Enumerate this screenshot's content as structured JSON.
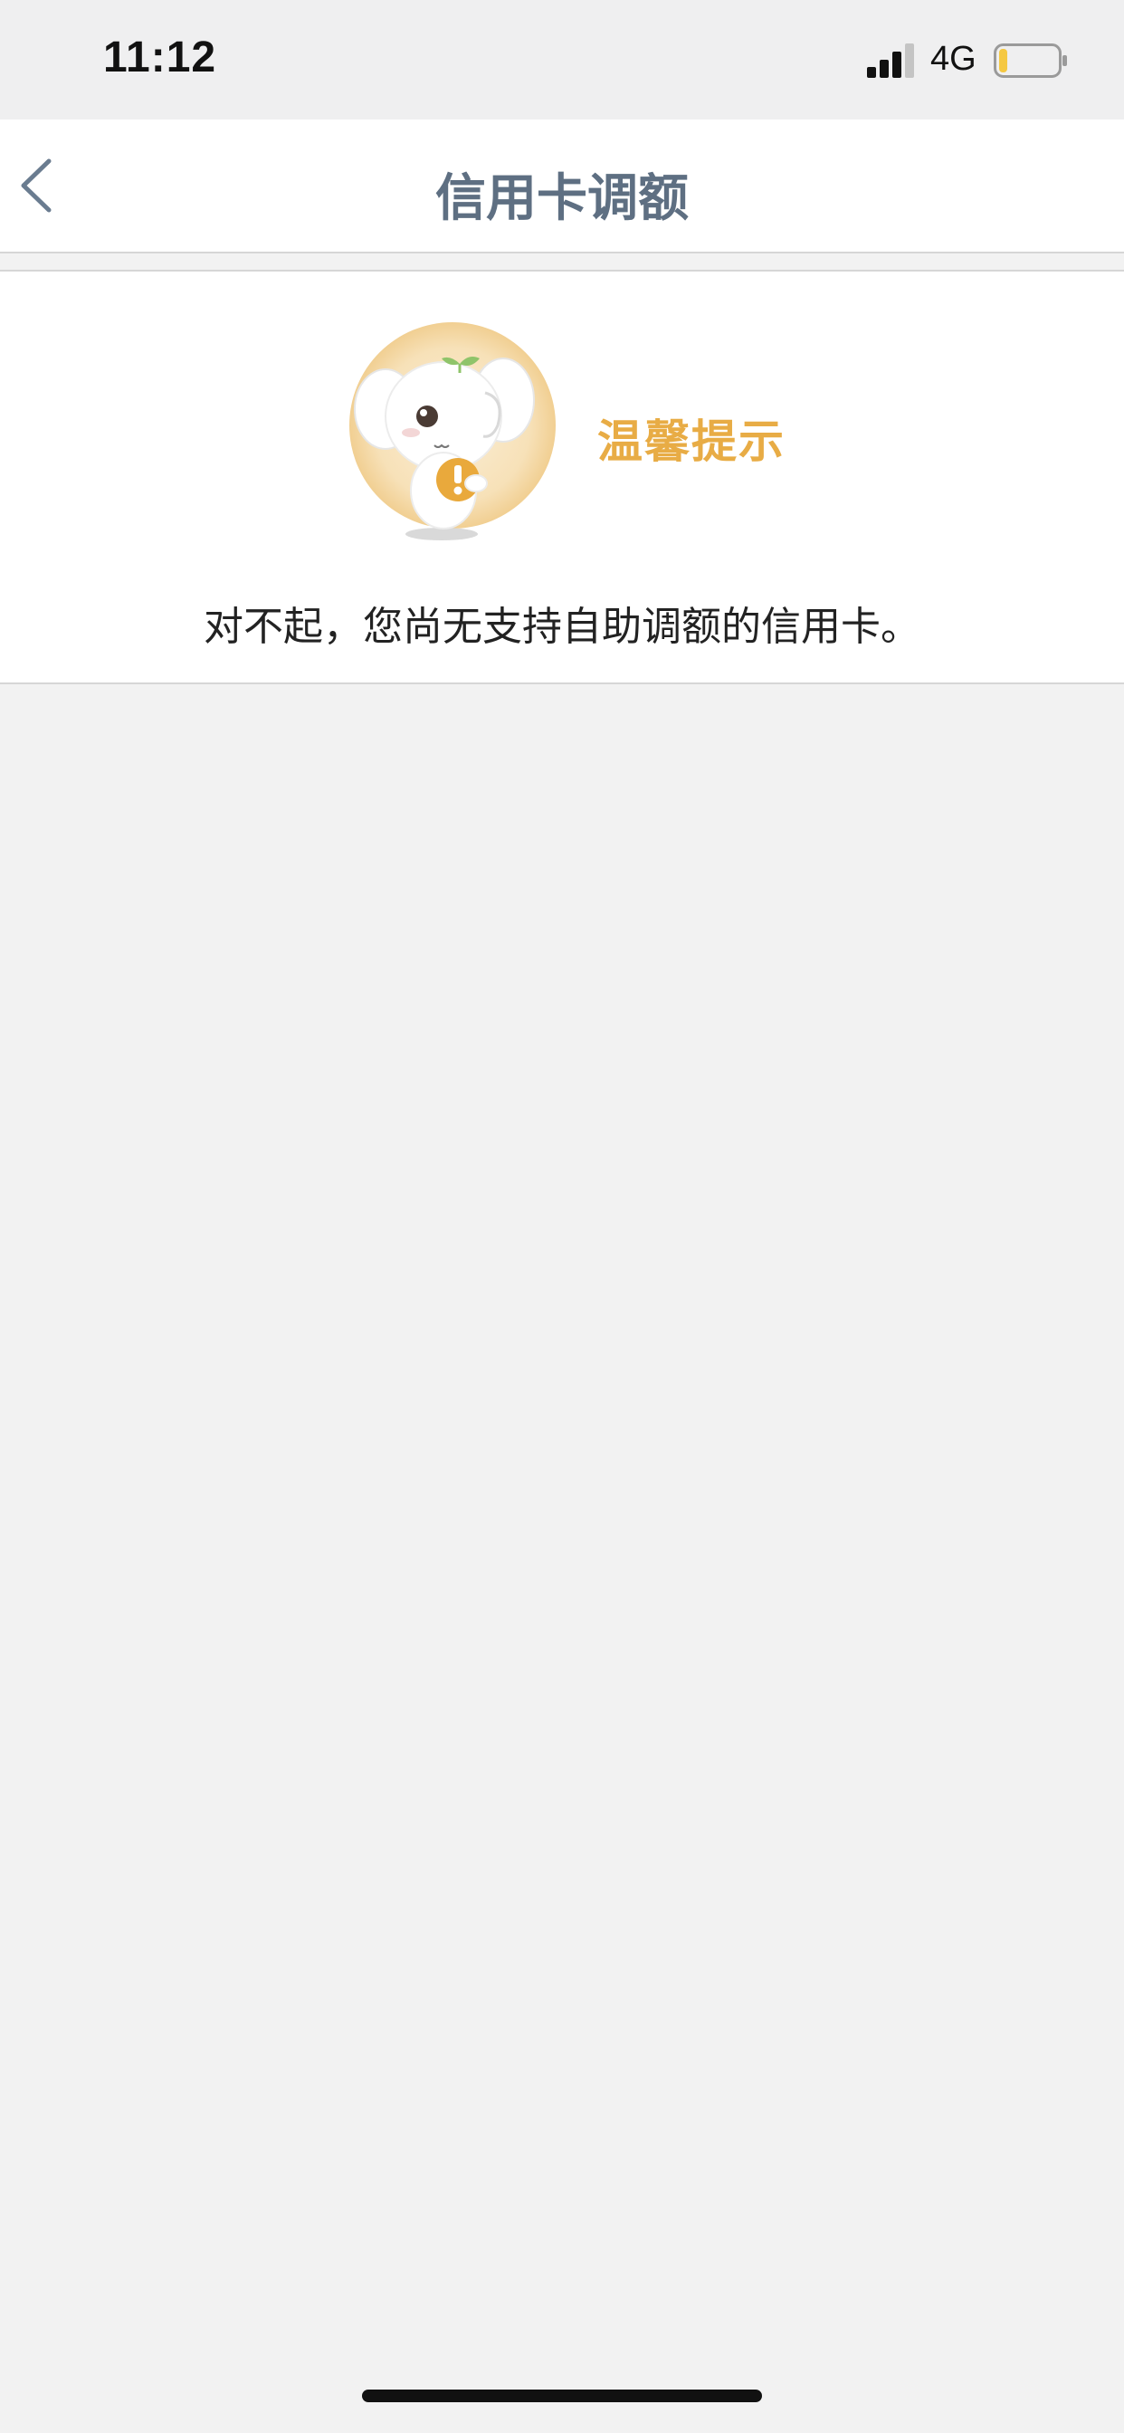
{
  "status_bar": {
    "time": "11:12",
    "network": "4G",
    "battery_level": 0.15,
    "battery_color": "#f5c842",
    "signal_bars_active": 3
  },
  "nav": {
    "title": "信用卡调额",
    "back_icon": "chevron-left-icon",
    "title_color": "#5e6f82"
  },
  "notice": {
    "heading": "温馨提示",
    "message": "对不起，您尚无支持自助调额的信用卡。",
    "heading_color": "#e8ac45",
    "mascot_icon": "elephant-mascot-icon"
  }
}
